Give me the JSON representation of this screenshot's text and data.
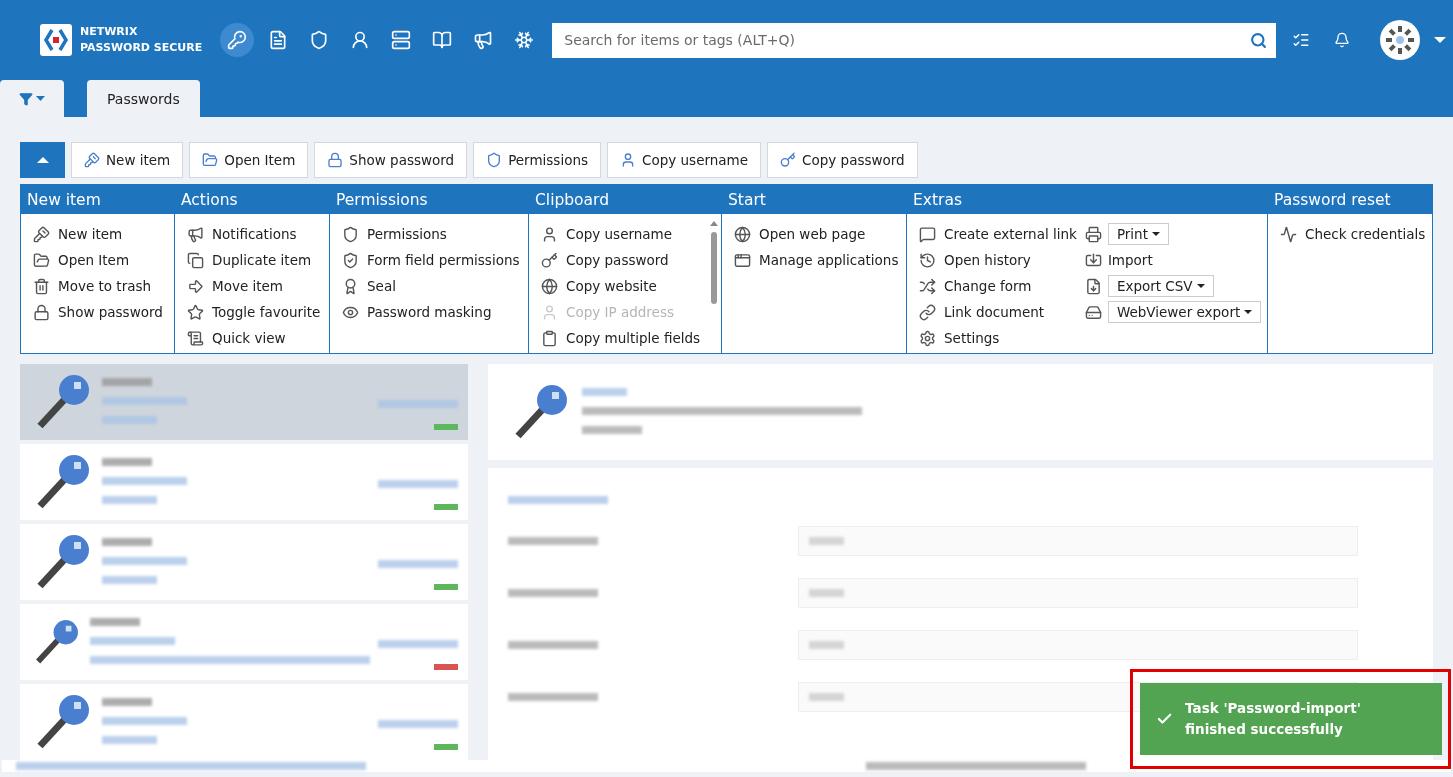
{
  "header": {
    "brand_line_1": "NETWRIX",
    "brand_line_2": "PASSWORD SECURE",
    "search": {
      "placeholder": "Search for items or tags (ALT+Q)"
    }
  },
  "tabs": [
    {
      "label": "Passwords",
      "selected": true
    }
  ],
  "toolbar": {
    "collapse_expanded": true,
    "buttons": [
      "New item",
      "Open Item",
      "Show password",
      "Permissions",
      "Copy username",
      "Copy password"
    ]
  },
  "ribbon": [
    {
      "title": "New item",
      "items": [
        {
          "label": "New item",
          "disabled": false
        },
        {
          "label": "Open Item",
          "disabled": false
        },
        {
          "label": "Move to trash",
          "disabled": false
        },
        {
          "label": "Show password",
          "disabled": false
        }
      ]
    },
    {
      "title": "Actions",
      "items": [
        {
          "label": "Notifications",
          "disabled": false
        },
        {
          "label": "Duplicate item",
          "disabled": false
        },
        {
          "label": "Move item",
          "disabled": false
        },
        {
          "label": "Toggle favourite",
          "disabled": false
        },
        {
          "label": "Quick view",
          "disabled": false
        }
      ]
    },
    {
      "title": "Permissions",
      "items": [
        {
          "label": "Permissions",
          "disabled": false
        },
        {
          "label": "Form field permissions",
          "disabled": false
        },
        {
          "label": "Seal",
          "disabled": false
        },
        {
          "label": "Password masking",
          "disabled": false
        }
      ]
    },
    {
      "title": "Clipboard",
      "items": [
        {
          "label": "Copy username",
          "disabled": false
        },
        {
          "label": "Copy password",
          "disabled": false
        },
        {
          "label": "Copy website",
          "disabled": false
        },
        {
          "label": "Copy IP address",
          "disabled": true
        },
        {
          "label": "Copy multiple fields",
          "disabled": false
        }
      ]
    },
    {
      "title": "Start",
      "items": [
        {
          "label": "Open web page",
          "disabled": false
        },
        {
          "label": "Manage applications",
          "disabled": false
        }
      ]
    },
    {
      "title": "Extras",
      "items": [
        {
          "label": "Create external link",
          "disabled": false
        },
        {
          "label": "Open history",
          "disabled": false
        },
        {
          "label": "Change form",
          "disabled": false
        },
        {
          "label": "Link document",
          "disabled": false
        },
        {
          "label": "Settings",
          "disabled": false
        }
      ],
      "side_items": [
        {
          "label": "Print",
          "kind": "dropdown"
        },
        {
          "label": "Import",
          "kind": "plain"
        },
        {
          "label": "Export CSV",
          "kind": "dropdown"
        },
        {
          "label": "WebViewer export",
          "kind": "dropdown"
        }
      ]
    },
    {
      "title": "Password reset",
      "items": [
        {
          "label": "Check credentials",
          "disabled": false
        }
      ]
    }
  ],
  "entries": [
    {
      "selected": true,
      "color": "#5cb85c"
    },
    {
      "selected": false,
      "color": "#5cb85c"
    },
    {
      "selected": false,
      "color": "#5cb85c"
    },
    {
      "selected": false,
      "color": "#d9534f"
    },
    {
      "selected": false,
      "color": "#5cb85c"
    }
  ],
  "toast": {
    "message": "Task 'Password-import' finished successfully"
  }
}
